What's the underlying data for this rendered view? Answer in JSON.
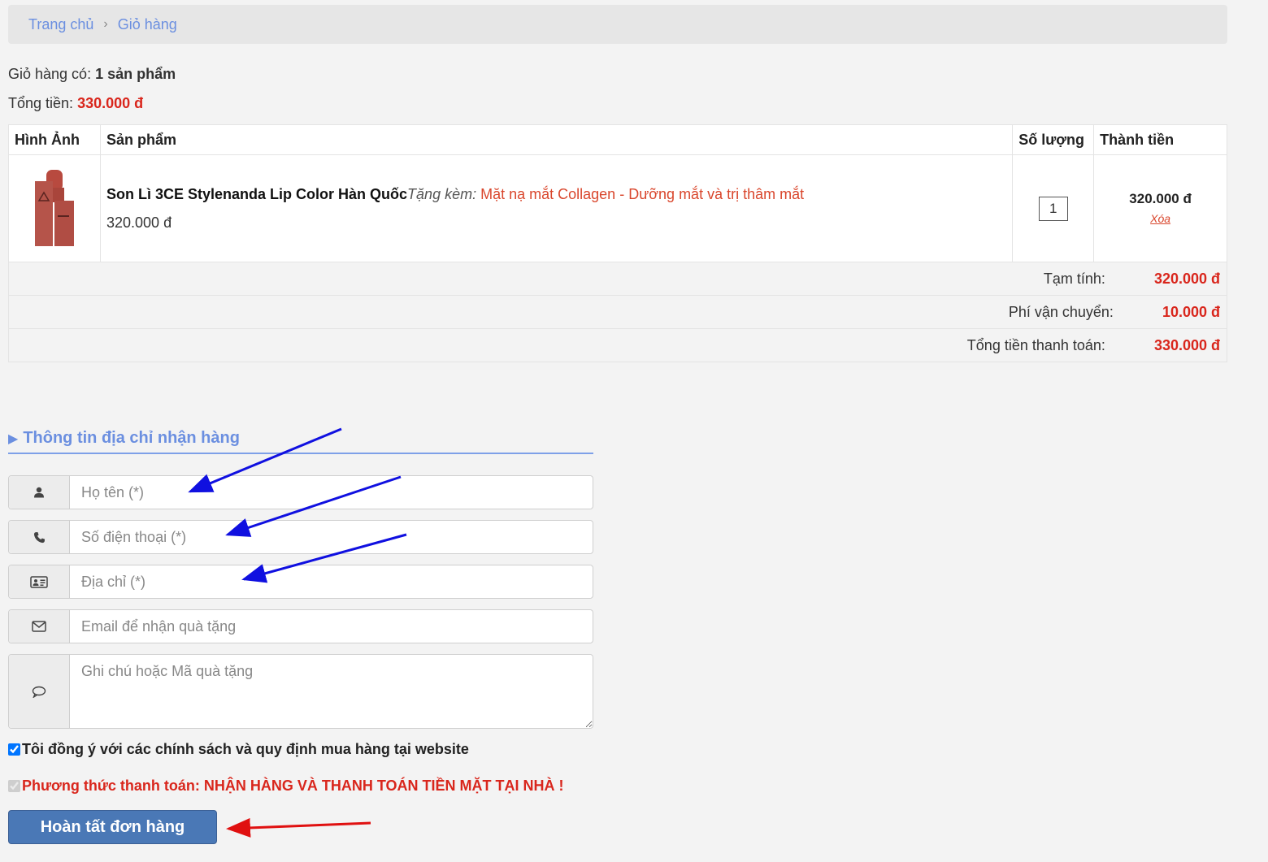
{
  "breadcrumb": {
    "home": "Trang chủ",
    "separator": "›",
    "current": "Giỏ hàng"
  },
  "summary": {
    "count_label": "Giỏ hàng có:",
    "count_value": "1 sản phẩm",
    "total_label": "Tổng tiền:",
    "total_value": "330.000 đ"
  },
  "table": {
    "headers": {
      "image": "Hình Ảnh",
      "product": "Sản phẩm",
      "qty": "Số lượng",
      "total": "Thành tiền"
    },
    "items": [
      {
        "name": "Son Lì 3CE Stylenanda Lip Color Hàn Quốc",
        "gift_label": "Tặng kèm:",
        "gift": "Mặt nạ mắt Collagen - Dưỡng mắt và trị thâm mắt",
        "price": "320.000 đ",
        "qty": "1",
        "line_total": "320.000 đ",
        "delete_label": "Xóa"
      }
    ],
    "totals": {
      "subtotal_label": "Tạm tính:",
      "subtotal": "320.000 đ",
      "shipping_label": "Phí vận chuyển:",
      "shipping": "10.000 đ",
      "grand_label": "Tổng tiền thanh toán:",
      "grand": "330.000 đ"
    }
  },
  "shipping_form": {
    "title": "Thông tin địa chỉ nhận hàng",
    "name_placeholder": "Họ tên (*)",
    "phone_placeholder": "Số điện thoại (*)",
    "address_placeholder": "Địa chỉ (*)",
    "email_placeholder": "Email để nhận quà tặng",
    "note_placeholder": "Ghi chú hoặc Mã quà tặng",
    "agree_label": "Tôi đồng ý với các chính sách và quy định mua hàng tại website",
    "agree_checked": true,
    "payment_label": "Phương thức thanh toán: NHẬN HÀNG VÀ THANH TOÁN TIỀN MẶT TẠI NHÀ !",
    "payment_checked": true,
    "submit_label": "Hoàn tất đơn hàng"
  },
  "colors": {
    "accent_blue": "#6b8fe0",
    "price_red": "#d9261c",
    "button_blue": "#4a78b6",
    "annotation_blue": "#1010e0",
    "annotation_red": "#e01010"
  },
  "icons": [
    "user-icon",
    "phone-icon",
    "id-card-icon",
    "envelope-icon",
    "comment-icon",
    "check-icon"
  ]
}
